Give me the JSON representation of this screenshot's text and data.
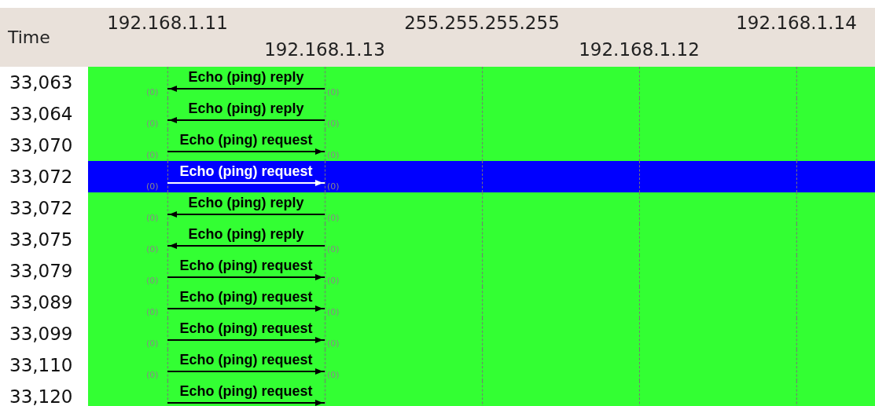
{
  "header": {
    "time_label": "Time",
    "hosts": [
      {
        "address": "192.168.1.11"
      },
      {
        "address": "192.168.1.13"
      },
      {
        "address": "255.255.255.255"
      },
      {
        "address": "192.168.1.12"
      },
      {
        "address": "192.168.1.14"
      }
    ]
  },
  "rows": [
    {
      "time": "33,063",
      "label": "Echo (ping) reply",
      "kind": "reply",
      "left_port": "(0)",
      "right_port": "(0)",
      "selected": false
    },
    {
      "time": "33,064",
      "label": "Echo (ping) reply",
      "kind": "reply",
      "left_port": "(0)",
      "right_port": "(0)",
      "selected": false
    },
    {
      "time": "33,070",
      "label": "Echo (ping) request",
      "kind": "request",
      "left_port": "(0)",
      "right_port": "(0)",
      "selected": false
    },
    {
      "time": "33,072",
      "label": "Echo (ping) request",
      "kind": "request",
      "left_port": "(0)",
      "right_port": "(0)",
      "selected": true
    },
    {
      "time": "33,072",
      "label": "Echo (ping) reply",
      "kind": "reply",
      "left_port": "(0)",
      "right_port": "(0)",
      "selected": false
    },
    {
      "time": "33,075",
      "label": "Echo (ping) reply",
      "kind": "reply",
      "left_port": "(0)",
      "right_port": "(0)",
      "selected": false
    },
    {
      "time": "33,079",
      "label": "Echo (ping) request",
      "kind": "request",
      "left_port": "(0)",
      "right_port": "(0)",
      "selected": false
    },
    {
      "time": "33,089",
      "label": "Echo (ping) request",
      "kind": "request",
      "left_port": "(0)",
      "right_port": "(0)",
      "selected": false
    },
    {
      "time": "33,099",
      "label": "Echo (ping) request",
      "kind": "request",
      "left_port": "(0)",
      "right_port": "(0)",
      "selected": false
    },
    {
      "time": "33,110",
      "label": "Echo (ping) request",
      "kind": "request",
      "left_port": "(0)",
      "right_port": "(0)",
      "selected": false
    },
    {
      "time": "33,120",
      "label": "Echo (ping) request",
      "kind": "request",
      "selected": false
    }
  ]
}
